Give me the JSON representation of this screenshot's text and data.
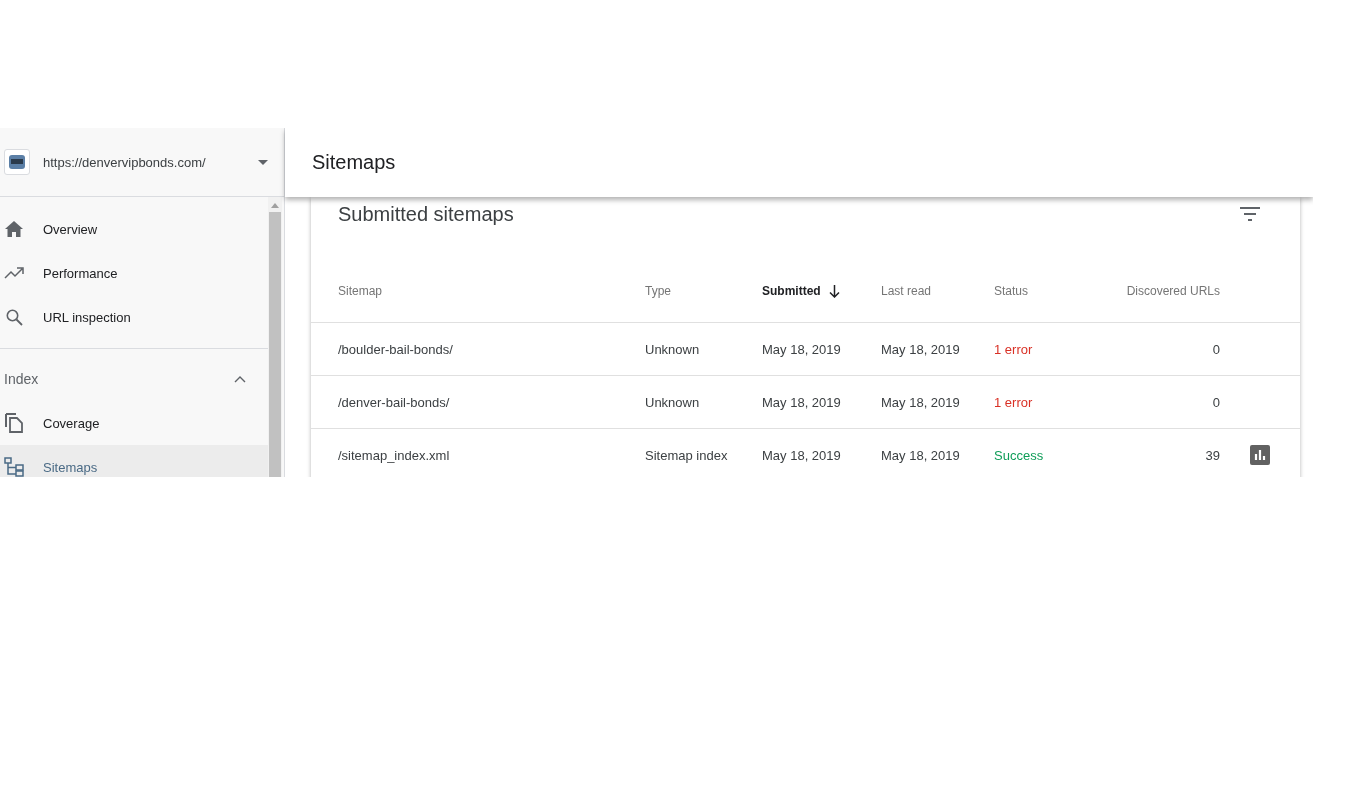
{
  "property": {
    "url": "https://denvervipbonds.com/"
  },
  "nav": {
    "items": [
      {
        "label": "Overview",
        "kind": "home",
        "selected": false
      },
      {
        "label": "Performance",
        "kind": "trend",
        "selected": false
      },
      {
        "label": "URL inspection",
        "kind": "search",
        "selected": false
      }
    ],
    "sections": [
      {
        "label": "Index",
        "expanded": true,
        "items": [
          {
            "label": "Coverage",
            "kind": "copy",
            "selected": false
          },
          {
            "label": "Sitemaps",
            "kind": "tree",
            "selected": true
          }
        ]
      }
    ]
  },
  "page": {
    "title": "Sitemaps"
  },
  "card": {
    "title": "Submitted sitemaps",
    "columns": [
      {
        "label": "Sitemap",
        "sorted": false
      },
      {
        "label": "Type",
        "sorted": false
      },
      {
        "label": "Submitted",
        "sorted": true
      },
      {
        "label": "Last read",
        "sorted": false
      },
      {
        "label": "Status",
        "sorted": false
      },
      {
        "label": "Discovered URLs",
        "sorted": false
      }
    ],
    "rows": [
      {
        "sitemap": "/boulder-bail-bonds/",
        "type": "Unknown",
        "submitted": "May 18, 2019",
        "last_read": "May 18, 2019",
        "status": "1 error",
        "kind": "error",
        "discovered": "0",
        "report": false
      },
      {
        "sitemap": "/denver-bail-bonds/",
        "type": "Unknown",
        "submitted": "May 18, 2019",
        "last_read": "May 18, 2019",
        "status": "1 error",
        "kind": "error",
        "discovered": "0",
        "report": false
      },
      {
        "sitemap": "/sitemap_index.xml",
        "type": "Sitemap index",
        "submitted": "May 18, 2019",
        "last_read": "May 18, 2019",
        "status": "Success",
        "kind": "success",
        "discovered": "39",
        "report": true
      }
    ]
  }
}
